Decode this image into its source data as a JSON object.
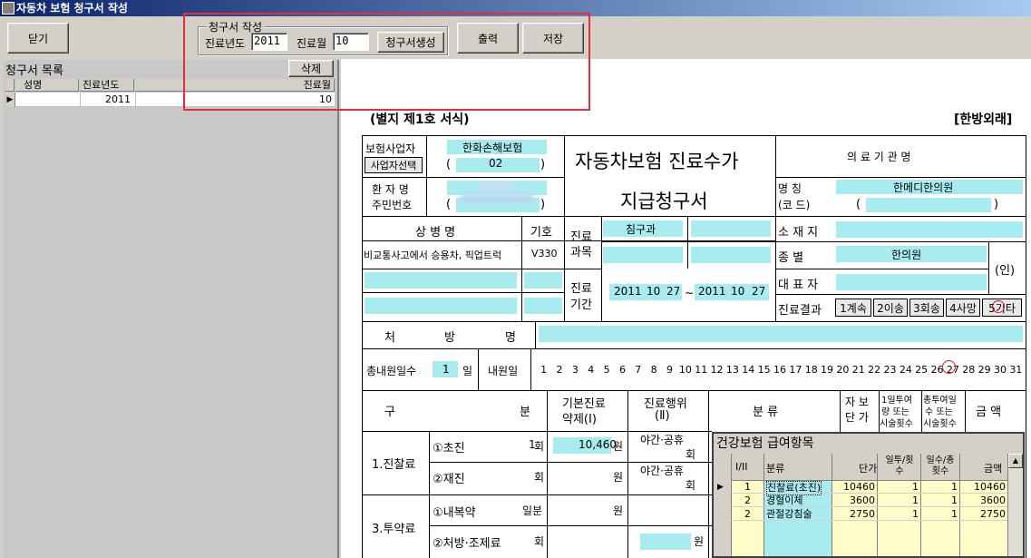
{
  "window": {
    "title": "자동차 보험 청구서 작성"
  },
  "toolbar": {
    "close_label": "닫기",
    "group_title": "청구서 작성",
    "year_label": "진료년도",
    "year_value": "2011",
    "month_label": "진료월",
    "month_value": "10",
    "generate_label": "청구서생성",
    "print_label": "출력",
    "save_label": "저장"
  },
  "claim_list": {
    "title": "청구서 목록",
    "delete_label": "삭제",
    "columns": [
      "성명",
      "진료년도",
      "진료월"
    ],
    "rows": [
      {
        "name": "",
        "year": "2011",
        "month": "10"
      }
    ]
  },
  "form": {
    "form_no": "(별지 제1호 서식)",
    "type": "[한방외래]",
    "title1": "자동차보험 진료수가",
    "title2": "지급청구서",
    "insurer_label": "보험사업자",
    "insurer_value": "한화손해보험",
    "insurer_select": "사업자선택",
    "insurer_code": "02",
    "paren_open": "(",
    "paren_close": ")",
    "patient_label": "환 자 명",
    "rrn_label": "주민번호",
    "institution_header": "의 료 기 관 명",
    "name_label": "명      칭",
    "code_label": "(코      드)",
    "institution_name": "한메디한의원",
    "address_label": "소 재 지",
    "kind_label": "종      별",
    "kind_value": "한의원",
    "rep_label": "대 표 자",
    "seal": "(인)",
    "result_label": "진료결과",
    "results": [
      "1계속",
      "2이송",
      "3회송",
      "4사망",
      "5기타"
    ],
    "disease_label": "상   병   명",
    "symbol_label": "기호",
    "disease_value": "비교통사고에서 승용차, 픽업트럭",
    "symbol_value": "V330",
    "dept_label1": "진료",
    "dept_label2": "과목",
    "dept_value": "침구과",
    "period_label1": "진료",
    "period_label2": "기간",
    "period_from": [
      "2011",
      "10",
      "27"
    ],
    "period_sep": "~",
    "period_to": [
      "2011",
      "10",
      "27"
    ],
    "rx_label": [
      "처",
      "방",
      "명"
    ],
    "visit_days_label": "총내원일수",
    "visit_days_value": "1",
    "visit_days_unit": "일",
    "visit_day_label": "내원일",
    "days": [
      "1",
      "2",
      "3",
      "4",
      "5",
      "6",
      "7",
      "8",
      "9",
      "10",
      "11",
      "12",
      "13",
      "14",
      "15",
      "16",
      "17",
      "18",
      "19",
      "20",
      "21",
      "22",
      "23",
      "24",
      "25",
      "26",
      "27",
      "28",
      "29",
      "30",
      "31"
    ],
    "col_gu": "구",
    "col_bun": "분",
    "col_base1": "기본진료",
    "col_base2": "약제(Ⅰ)",
    "col_act1": "진료행위",
    "col_act2": "(Ⅱ)",
    "col_cat": "분      류",
    "col_unit1": "자 보",
    "col_unit2": "단 가",
    "col_dose1": "1일투여",
    "col_dose2": "량 또는",
    "col_dose3": "시술횟수",
    "col_total1": "총투여일",
    "col_total2": "수 또는",
    "col_total3": "시술횟수",
    "col_amount": "금    액",
    "sec1": "1.진찰료",
    "first_visit": "①초진",
    "first_visit_count": "1",
    "unit_times": "회",
    "first_visit_amount": "10,460",
    "unit_won": "원",
    "revisit": "②재진",
    "night1": "야간·공휴",
    "night2": "회",
    "sec3": "3.투약료",
    "internal": "①내복약",
    "unit_days": "일분",
    "prescription": "②처방·조제료"
  },
  "subgrid": {
    "title": "건강보험 급여항목",
    "columns": [
      "I/II",
      "분류",
      "단가",
      "일투/횟수",
      "일수/총횟수",
      "금액"
    ],
    "rows": [
      {
        "type": "1",
        "name": "진찰료(초진)",
        "price": "10460",
        "daily": "1",
        "days": "1",
        "amount": "10460"
      },
      {
        "type": "2",
        "name": "경혈이체",
        "price": "3600",
        "daily": "1",
        "days": "1",
        "amount": "3600"
      },
      {
        "type": "2",
        "name": "관절강침술",
        "price": "2750",
        "daily": "1",
        "days": "1",
        "amount": "2750"
      }
    ]
  }
}
